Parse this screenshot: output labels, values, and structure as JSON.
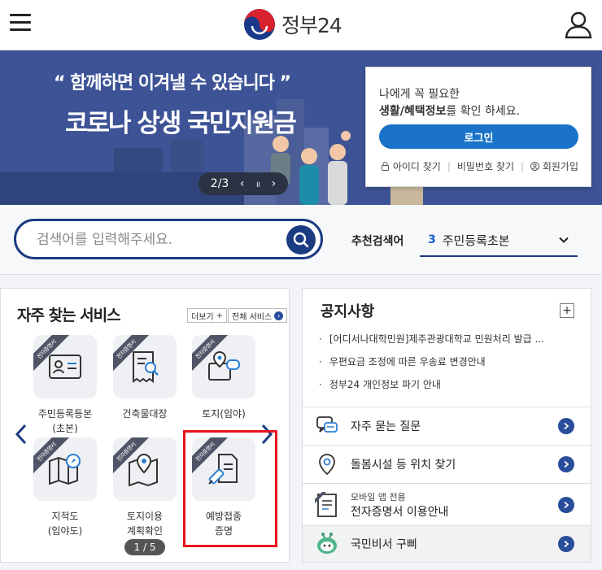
{
  "header": {
    "logo_text": "정부24"
  },
  "banner": {
    "quote": "“ 함께하면 이겨낼 수 있습니다 ”",
    "title": "코로나 상생 국민지원금",
    "slide_counter": "2/3",
    "prev": "‹",
    "pause": "॥",
    "next": "›"
  },
  "login_card": {
    "line1": "나에게 꼭 필요한",
    "line2_bold": "생활/혜택정보",
    "line2_rest": "를 확인 하세요.",
    "login_button": "로그인",
    "find_id": "아이디 찾기",
    "find_pw": "비밀번호 찾기",
    "signup": "회원가입"
  },
  "search": {
    "placeholder": "검색어를 입력해주세요.",
    "recommend_label": "추천검색어",
    "recommend_rank": "3",
    "recommend_term": "주민등록초본"
  },
  "services": {
    "title": "자주 찾는 서비스",
    "more_label": "더보기",
    "all_label": "전체 서비스",
    "ribbon": "전자증명서",
    "items": [
      {
        "label": "주민등록등본\n(초본)",
        "icon": "id-card-icon"
      },
      {
        "label": "건축물대장",
        "icon": "receipt-search-icon"
      },
      {
        "label": "토지(임야)\n대장",
        "icon": "map-chat-icon"
      },
      {
        "label": "지적도\n(임야도)",
        "icon": "map-compass-icon"
      },
      {
        "label": "토지이용\n계획확인",
        "icon": "map-pin-icon"
      },
      {
        "label": "예방접종\n증명",
        "icon": "syringe-document-icon"
      }
    ],
    "pager": "1 / 5"
  },
  "notice": {
    "title": "공지사항",
    "plus": "+",
    "items": [
      "[어디서나대학민원]제주관광대학교 민원처리 발급 ...",
      "우편요금 조정에 따른 우송료 변경안내",
      "정부24 개인정보 파기 안내"
    ]
  },
  "quick_links": [
    {
      "label": "자주 묻는 질문",
      "icon": "chat-bubbles-icon"
    },
    {
      "label": "돌봄시설 등 위치 찾기",
      "icon": "location-pin-icon"
    },
    {
      "sub": "모바일 앱 전용",
      "label": "전자증명서 이용안내",
      "icon": "certificate-icon"
    },
    {
      "label": "국민비서 구삐",
      "icon": "robot-mascot-icon"
    }
  ],
  "colors": {
    "primary": "#1b3b82",
    "accent_blue": "#1a73c8",
    "banner_bg": "#3d5396",
    "highlight": "#e8141e"
  }
}
